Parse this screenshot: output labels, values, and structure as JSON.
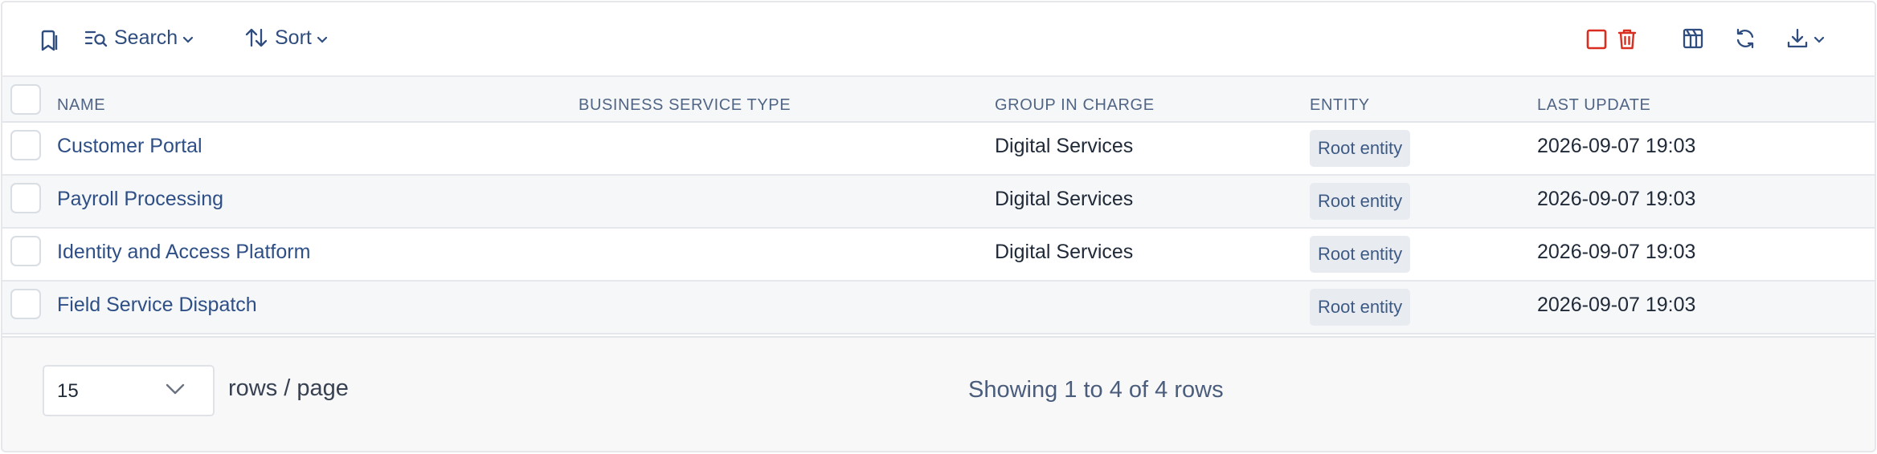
{
  "toolbar": {
    "bookmark_icon": "bookmark-icon",
    "search_label": "Search",
    "sort_label": "Sort",
    "colors": {
      "text": "#2f4d7e",
      "danger": "#d92d20"
    }
  },
  "table": {
    "headers": {
      "name": "NAME",
      "business_service_type": "BUSINESS SERVICE TYPE",
      "group_in_charge": "GROUP IN CHARGE",
      "entity": "ENTITY",
      "last_update": "LAST UPDATE"
    },
    "rows": [
      {
        "name": "Customer Portal",
        "business_service_type": "",
        "group_in_charge": "Digital Services",
        "entity": "Root entity",
        "last_update": "2026-09-07 19:03"
      },
      {
        "name": "Payroll Processing",
        "business_service_type": "",
        "group_in_charge": "Digital Services",
        "entity": "Root entity",
        "last_update": "2026-09-07 19:03"
      },
      {
        "name": "Identity and Access Platform",
        "business_service_type": "",
        "group_in_charge": "Digital Services",
        "entity": "Root entity",
        "last_update": "2026-09-07 19:03"
      },
      {
        "name": "Field Service Dispatch",
        "business_service_type": "",
        "group_in_charge": "",
        "entity": "Root entity",
        "last_update": "2026-09-07 19:03"
      }
    ]
  },
  "footer": {
    "page_size": "15",
    "rows_per_page_label": "rows / page",
    "showing_text": "Showing 1 to 4 of 4 rows"
  }
}
